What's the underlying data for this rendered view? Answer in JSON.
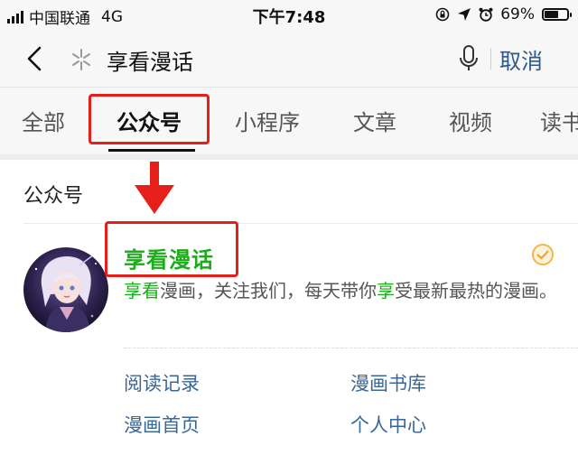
{
  "status_bar": {
    "carrier": "中国联通",
    "network": "4G",
    "time": "下午7:48",
    "battery_text": "69%",
    "battery_level": 0.69
  },
  "search": {
    "query": "享看漫话",
    "cancel": "取消"
  },
  "tabs": [
    {
      "label": "全部"
    },
    {
      "label": "公众号",
      "active": true
    },
    {
      "label": "小程序"
    },
    {
      "label": "文章"
    },
    {
      "label": "视频"
    },
    {
      "label": "读书"
    }
  ],
  "section": {
    "title": "公众号"
  },
  "account": {
    "name": "享看漫话",
    "desc_parts": [
      {
        "text": "享看",
        "hl": true
      },
      {
        "text": "漫画，关注我们，每天带你",
        "hl": false
      },
      {
        "text": "享",
        "hl": true
      },
      {
        "text": "受最新最热的漫画。",
        "hl": false
      }
    ]
  },
  "menu": [
    "阅读记录",
    "漫画书库",
    "漫画首页",
    "个人中心"
  ],
  "colors": {
    "annotation_red": "#e5201b",
    "highlight_green": "#1aad19",
    "link_blue": "#3a6796"
  }
}
